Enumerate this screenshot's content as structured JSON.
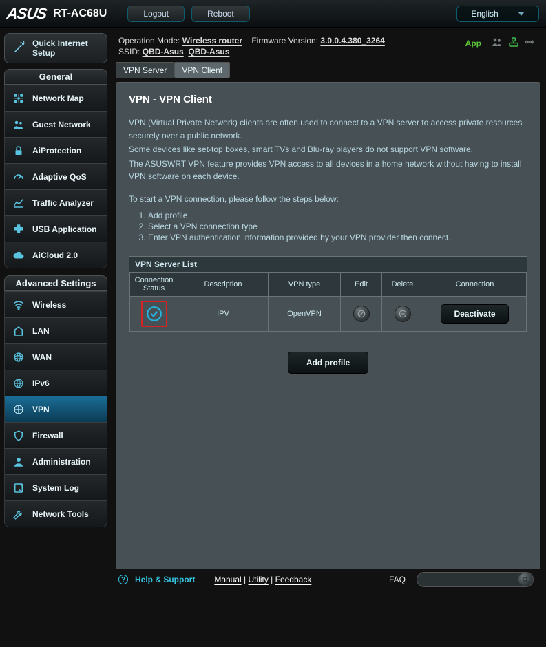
{
  "header": {
    "brand": "ASUS",
    "model": "RT-AC68U",
    "logout": "Logout",
    "reboot": "Reboot",
    "language": "English"
  },
  "info": {
    "op_mode_label": "Operation Mode:",
    "op_mode_value": "Wireless router",
    "fw_label": "Firmware Version:",
    "fw_value": "3.0.0.4.380_3264",
    "ssid_label": "SSID:",
    "ssid_24": "QBD-Asus",
    "ssid_5": "QBD-Asus",
    "app_label": "App"
  },
  "tabs": {
    "server": "VPN Server",
    "client": "VPN Client"
  },
  "quick_setup": "Quick Internet Setup",
  "sections": {
    "general": "General",
    "advanced": "Advanced Settings"
  },
  "nav_general": [
    "Network Map",
    "Guest Network",
    "AiProtection",
    "Adaptive QoS",
    "Traffic Analyzer",
    "USB Application",
    "AiCloud 2.0"
  ],
  "nav_advanced": [
    "Wireless",
    "LAN",
    "WAN",
    "IPv6",
    "VPN",
    "Firewall",
    "Administration",
    "System Log",
    "Network Tools"
  ],
  "panel": {
    "title": "VPN - VPN Client",
    "p1": "VPN (Virtual Private Network) clients are often used to connect to a VPN server to access private resources securely over a public network.",
    "p2": "Some devices like set-top boxes, smart TVs and Blu-ray players do not support VPN software.",
    "p3": "The ASUSWRT VPN feature provides VPN access to all devices in a home network without having to install VPN software on each device.",
    "steps_intro": "To start a VPN connection, please follow the steps below:",
    "steps": [
      "Add profile",
      "Select a VPN connection type",
      "Enter VPN authentication information provided by your VPN provider then connect."
    ],
    "table_title": "VPN Server List",
    "cols": {
      "conn_status": "Connection Status",
      "desc": "Description",
      "vpn_type": "VPN type",
      "edit": "Edit",
      "delete": "Delete",
      "connection": "Connection"
    },
    "row": {
      "desc": "IPV",
      "vpn_type": "OpenVPN",
      "action": "Deactivate"
    },
    "add_profile": "Add profile"
  },
  "footer": {
    "help": "Help & Support",
    "manual": "Manual",
    "utility": "Utility",
    "feedback": "Feedback",
    "faq": "FAQ"
  }
}
